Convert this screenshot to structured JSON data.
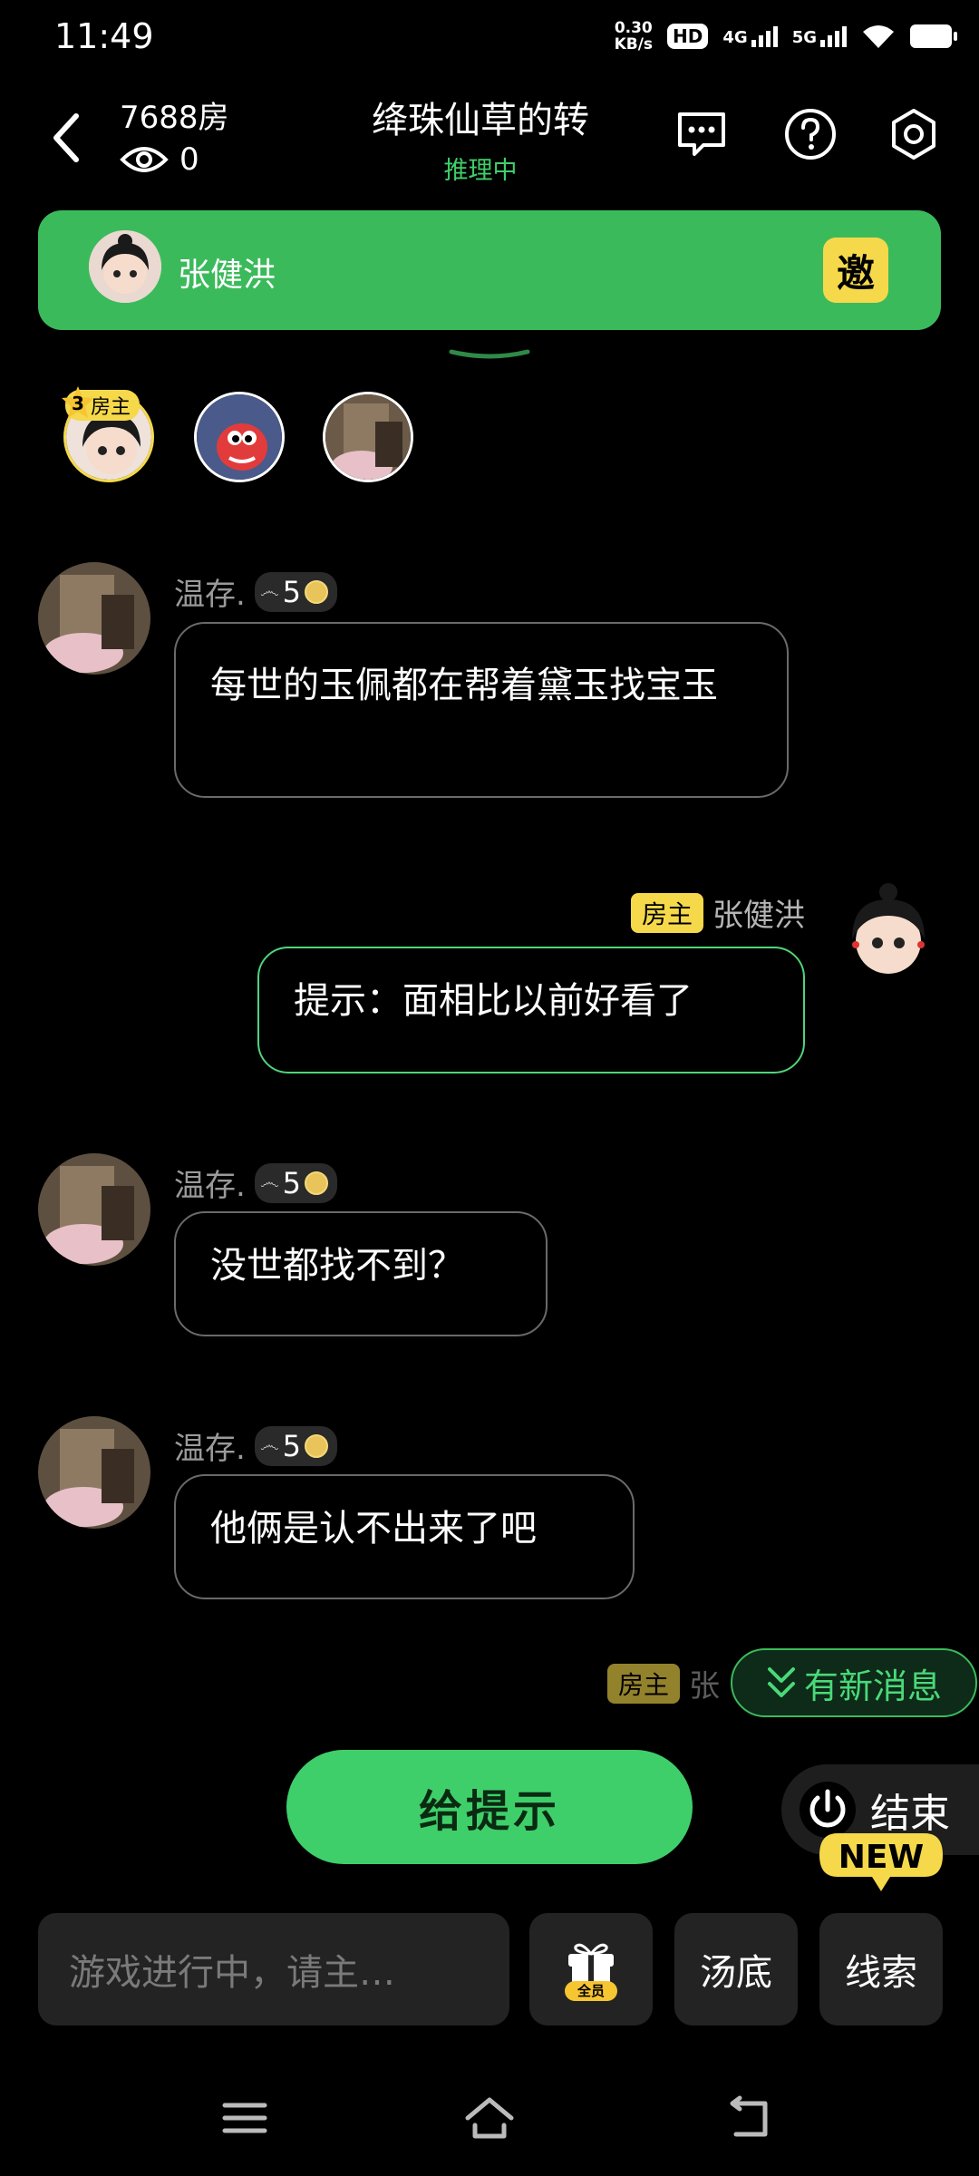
{
  "status_bar": {
    "time": "11:49",
    "net_speed_value": "0.30",
    "net_speed_unit": "KB/s",
    "hd": "HD",
    "net1": "4G",
    "net2": "5G"
  },
  "header": {
    "room_number": "7688房",
    "viewer_count": "0",
    "title": "绛珠仙草的转",
    "status": "推理中"
  },
  "invite_bar": {
    "name": "张健洪",
    "invite_label": "邀"
  },
  "players": {
    "host_level": "3",
    "host_badge": "房主"
  },
  "messages": [
    {
      "sender": "温存.",
      "level": "5",
      "text": "每世的玉佩都在帮着黛玉找宝玉"
    },
    {
      "sender": "张健洪",
      "badge": "房主",
      "text": "提示：面相比以前好看了"
    },
    {
      "sender": "温存.",
      "level": "5",
      "text": "没世都找不到？"
    },
    {
      "sender": "温存.",
      "level": "5",
      "text": "他俩是认不出来了吧"
    },
    {
      "sender": "张",
      "badge": "房主"
    }
  ],
  "new_messages_label": "有新消息",
  "actions": {
    "hint_label": "给提示",
    "end_label": "结束",
    "new_badge": "NEW"
  },
  "bottom": {
    "input_placeholder": "游戏进行中，请主…",
    "gift_badge": "全员",
    "answer_label": "汤底",
    "clue_label": "线索"
  },
  "colors": {
    "accent_green": "#3fcf6a",
    "badge_yellow": "#f6d94a",
    "background": "#000000"
  }
}
